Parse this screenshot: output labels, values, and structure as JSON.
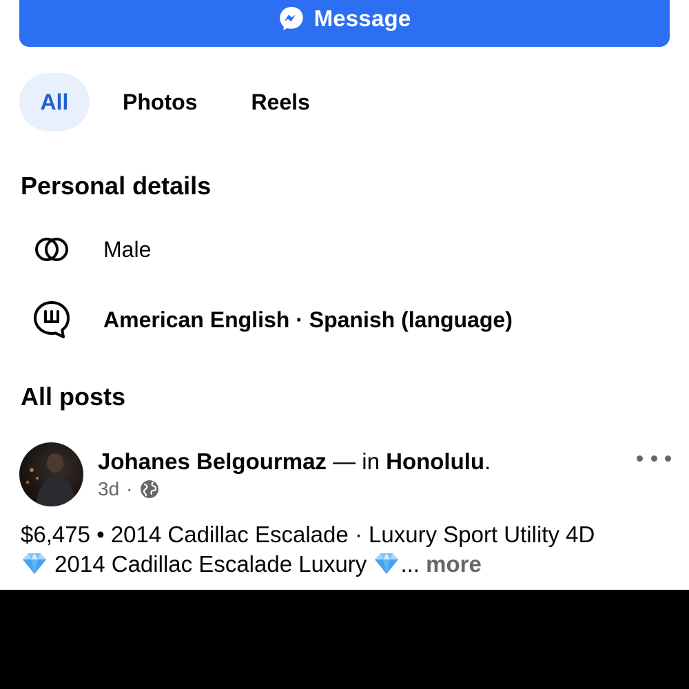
{
  "message_button": {
    "label": "Message",
    "icon": "messenger-icon",
    "color": "#2d6ff3"
  },
  "tabs": [
    {
      "label": "All",
      "active": true
    },
    {
      "label": "Photos",
      "active": false
    },
    {
      "label": "Reels",
      "active": false
    }
  ],
  "personal_details": {
    "title": "Personal details",
    "items": [
      {
        "icon": "gender-icon",
        "text": "Male"
      },
      {
        "icon": "language-icon",
        "text": "American English · Spanish (language)"
      }
    ]
  },
  "all_posts": {
    "title": "All posts",
    "post": {
      "author": "Johanes Belgourmaz",
      "connector": " — in ",
      "location": "Honolulu",
      "location_suffix": ".",
      "time": "3d",
      "separator": "·",
      "audience_icon": "globe-icon",
      "line1": "$6,475 • 2014 Cadillac Escalade · Luxury Sport Utility 4D",
      "line2_text": " 2014 Cadillac Escalade Luxury ",
      "ellipsis": "... ",
      "more_label": "more",
      "emoji_icon": "gem-icon"
    }
  }
}
